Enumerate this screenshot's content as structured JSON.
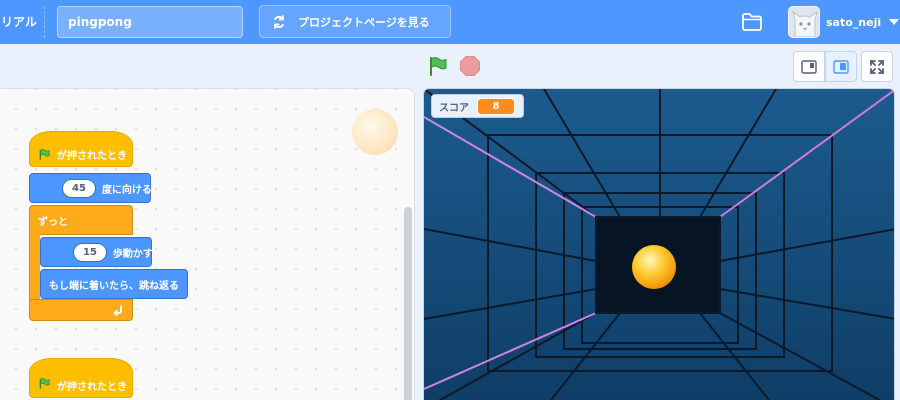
{
  "menu": {
    "tutorial_label": "リアル",
    "project_title": "pingpong",
    "see_project_label": "プロジェクトページを見る",
    "username": "sato_neji"
  },
  "stage_controls": {
    "green_flag_icon": "green-flag-icon",
    "stop_icon": "stop-icon",
    "view_buttons": [
      "small-stage-icon",
      "normal-stage-icon",
      "fullscreen-icon"
    ]
  },
  "scripts": {
    "script1": {
      "when_flag_clicked": "が押されたとき",
      "point_direction_value": "45",
      "point_direction_label": "度に向ける",
      "forever_label": "ずっと",
      "move_value": "15",
      "move_label": "歩動かす",
      "bounce_label": "もし端に着いたら、跳ね返る"
    },
    "script2": {
      "when_flag_clicked": "が押されたとき"
    }
  },
  "stage": {
    "score_label": "スコア",
    "score_value": "8"
  },
  "colors": {
    "menu_blue": "#4d97ff",
    "events_yellow": "#ffbf00",
    "motion_blue": "#4c97ff",
    "control_orange": "#ffab19",
    "score_orange": "#ff8c1a"
  }
}
